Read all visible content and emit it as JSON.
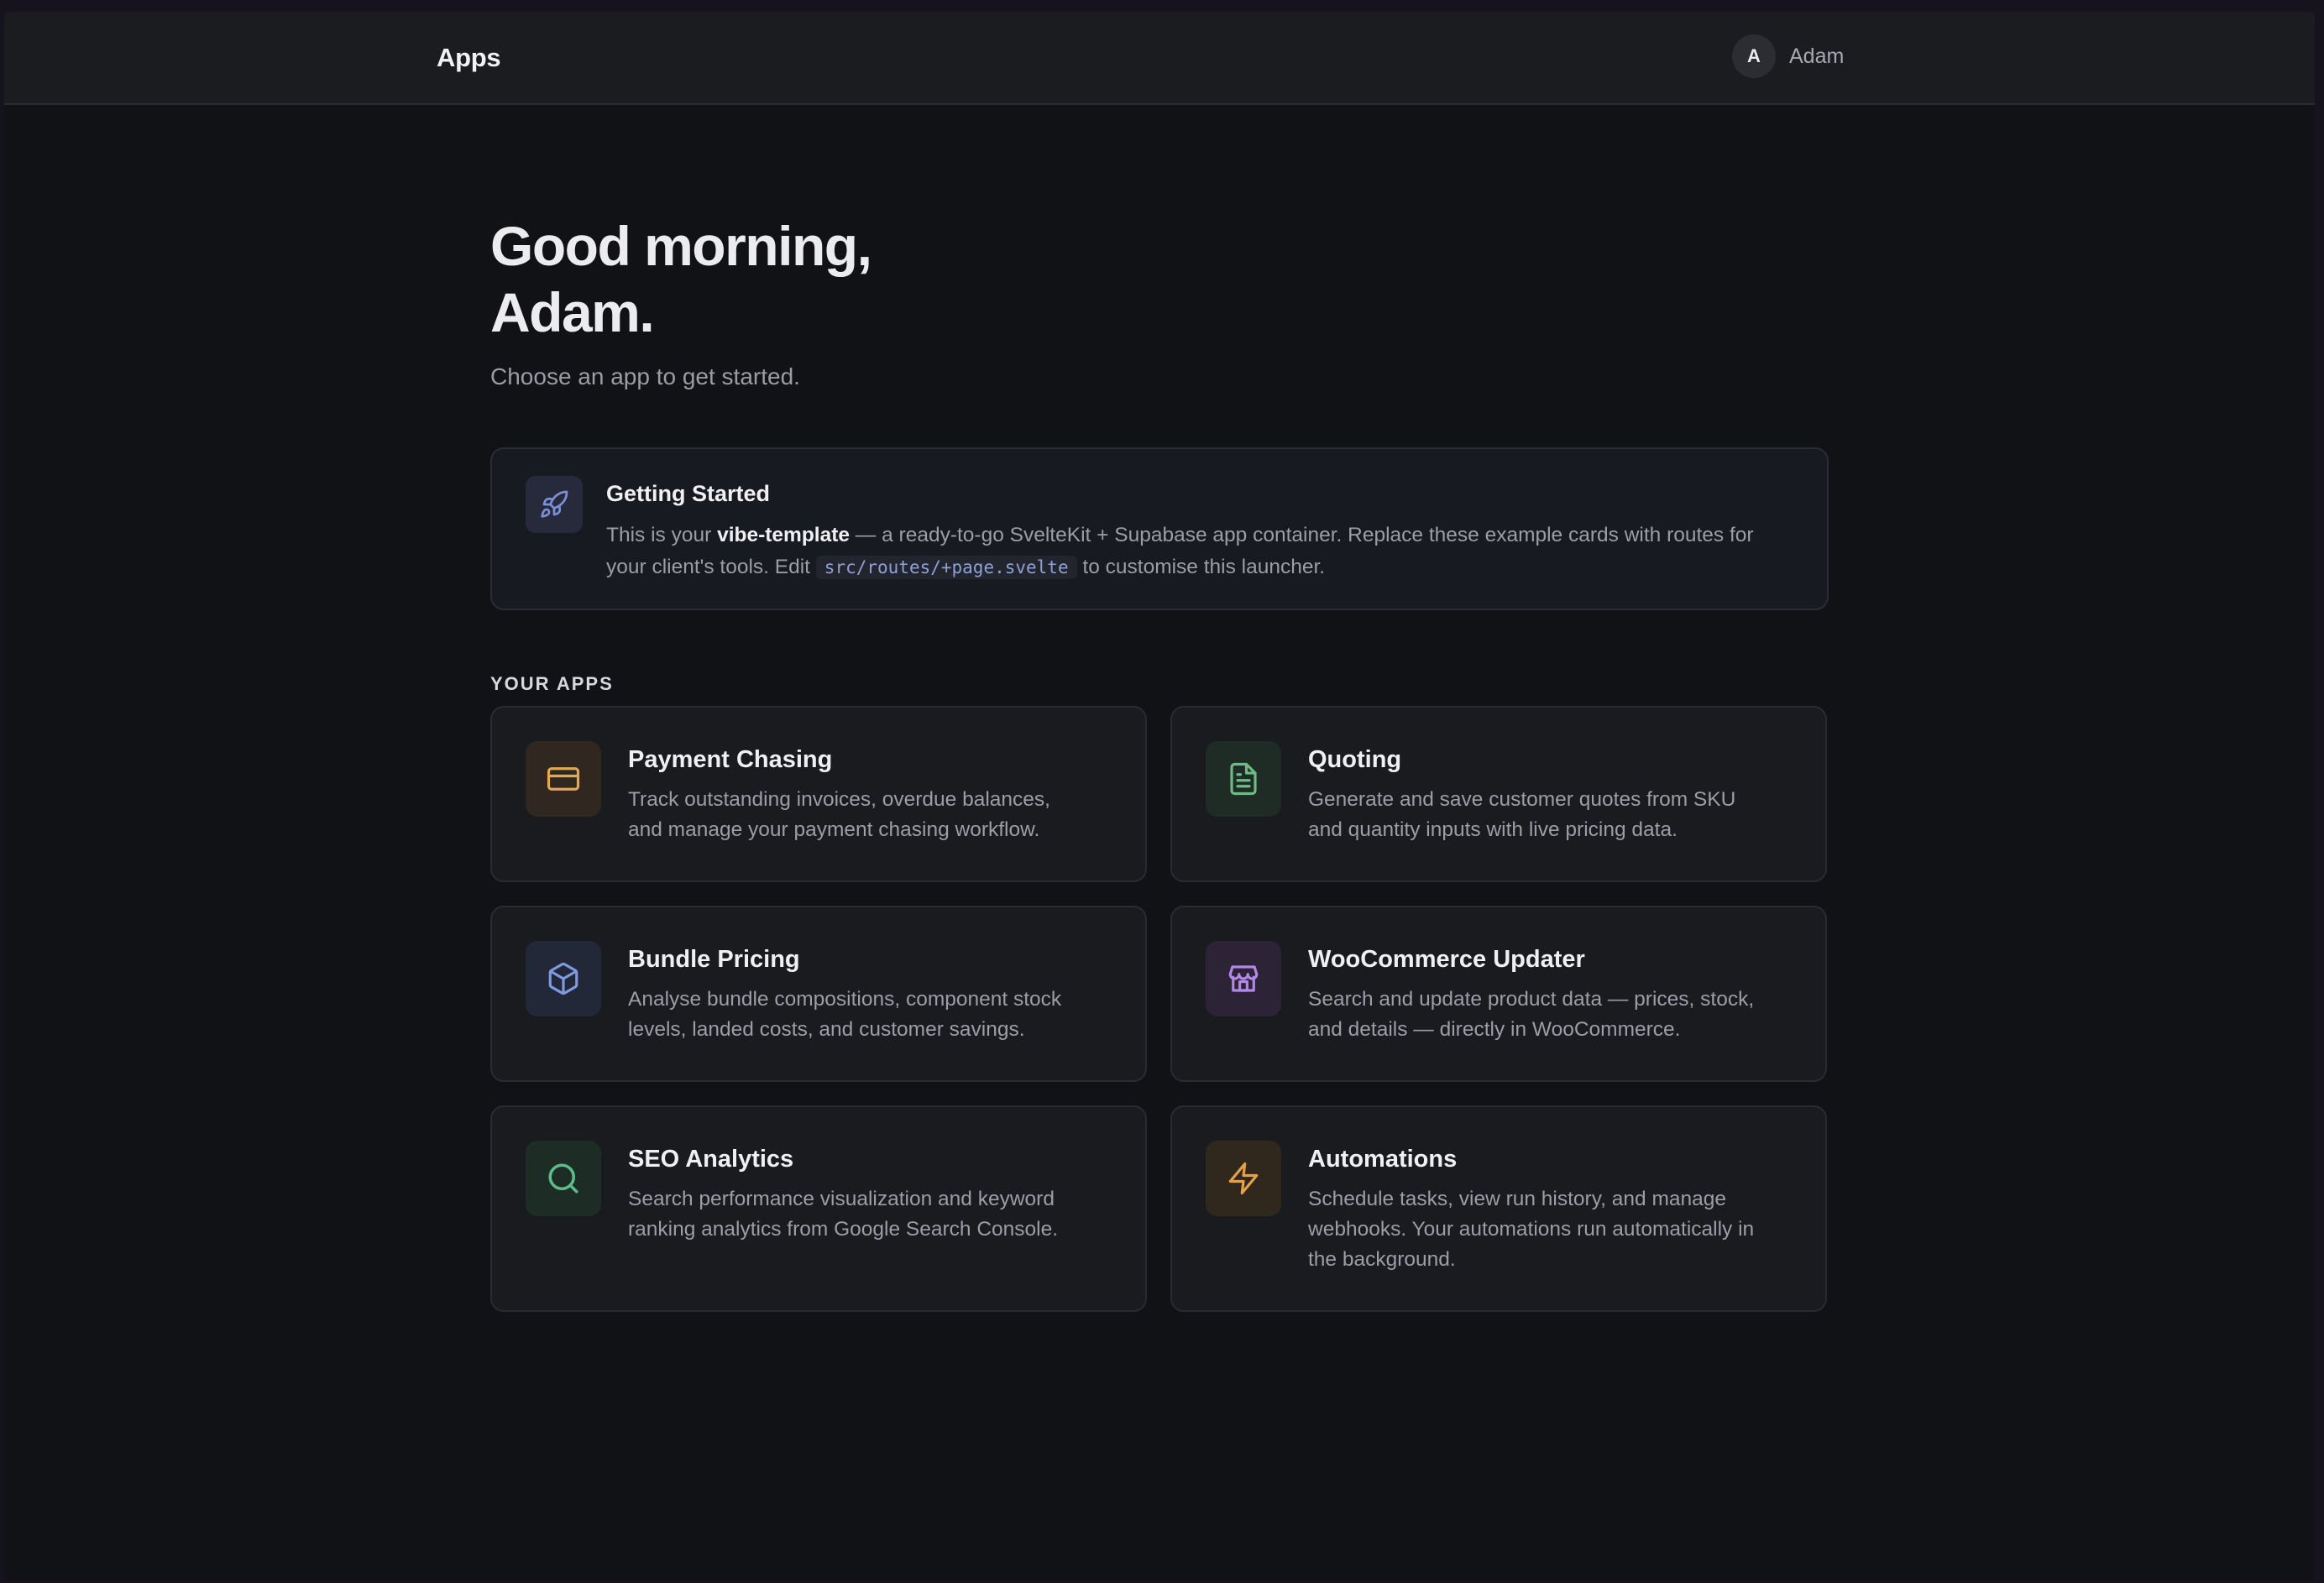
{
  "header": {
    "title": "Apps",
    "user": {
      "initial": "A",
      "name": "Adam"
    }
  },
  "hero": {
    "greeting": "Good morning, Adam.",
    "subtitle": "Choose an app to get started."
  },
  "getting_started": {
    "icon": "rocket-icon",
    "title": "Getting Started",
    "text_before": "This is your ",
    "template_name": "vibe-template",
    "text_middle": " — a ready-to-go SvelteKit + Supabase app container. Replace these example cards with routes for your client's tools. Edit ",
    "code": "src/routes/+page.svelte",
    "text_after": " to customise this launcher."
  },
  "apps_section": {
    "label": "YOUR APPS",
    "items": [
      {
        "title": "Payment Chasing",
        "description": "Track outstanding invoices, overdue balances, and manage your payment chasing workflow.",
        "icon": "credit-card-icon",
        "color": "#e3a857",
        "icon_bg": "#302820"
      },
      {
        "title": "Quoting",
        "description": "Generate and save customer quotes from SKU and quantity inputs with live pricing data.",
        "icon": "document-icon",
        "color": "#6dbb86",
        "icon_bg": "#1f2c26"
      },
      {
        "title": "Bundle Pricing",
        "description": "Analyse bundle compositions, component stock levels, landed costs, and customer savings.",
        "icon": "package-icon",
        "color": "#7d9be0",
        "icon_bg": "#232838"
      },
      {
        "title": "WooCommerce Updater",
        "description": "Search and update product data — prices, stock, and details — directly in WooCommerce.",
        "icon": "store-icon",
        "color": "#b287e6",
        "icon_bg": "#2c2337"
      },
      {
        "title": "SEO Analytics",
        "description": "Search performance visualization and keyword ranking analytics from Google Search Console.",
        "icon": "search-icon",
        "color": "#5cbd8a",
        "icon_bg": "#1e2c26"
      },
      {
        "title": "Automations",
        "description": "Schedule tasks, view run history, and manage webhooks. Your automations run automatically in the background.",
        "icon": "lightning-icon",
        "color": "#e3a24a",
        "icon_bg": "#30281d"
      }
    ]
  }
}
